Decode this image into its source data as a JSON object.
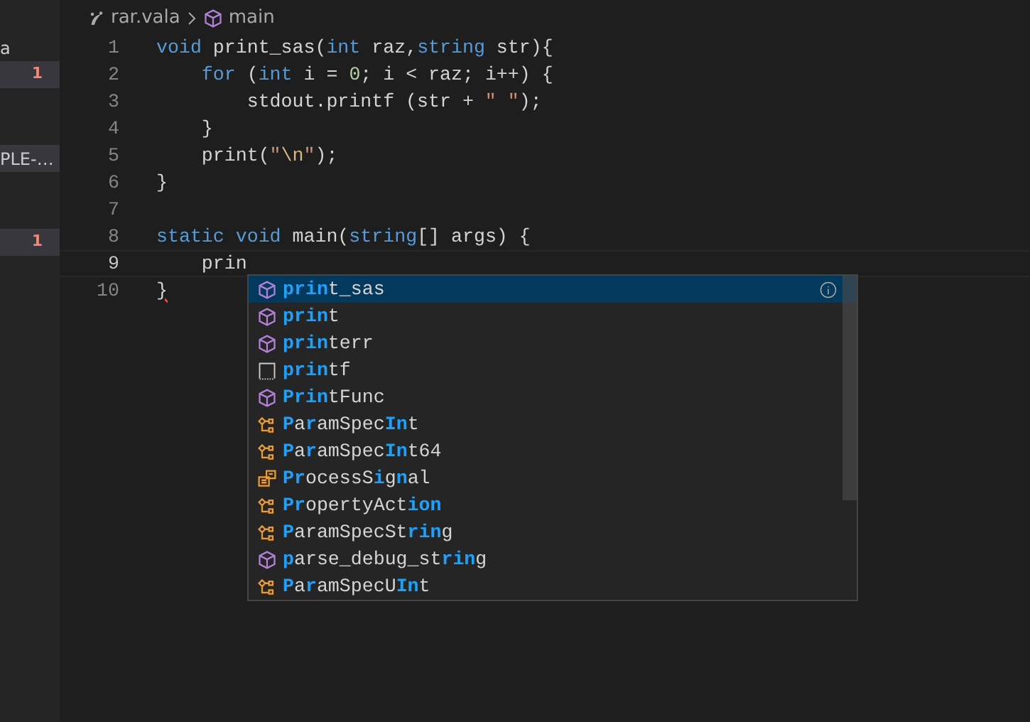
{
  "sidebar": {
    "items": [
      {
        "label": "a",
        "selected": false
      },
      {
        "badge": "1",
        "selected": true
      },
      {
        "label": "PLE-…",
        "selected": true
      },
      {
        "badge": "1",
        "selected": true
      }
    ]
  },
  "breadcrumb": [
    {
      "kind": "file",
      "label": "rar.vala"
    },
    {
      "kind": "method",
      "label": "main"
    }
  ],
  "editor": {
    "lines": [
      {
        "number": "1",
        "tokens": [
          {
            "kind": "keyword",
            "text": "void"
          },
          {
            "kind": "plain",
            "text": " print_sas("
          },
          {
            "kind": "keyword",
            "text": "int"
          },
          {
            "kind": "plain",
            "text": " raz,"
          },
          {
            "kind": "keyword",
            "text": "string"
          },
          {
            "kind": "plain",
            "text": " str){"
          }
        ]
      },
      {
        "number": "2",
        "tokens": [
          {
            "kind": "keyword",
            "text": "    for"
          },
          {
            "kind": "plain",
            "text": " ("
          },
          {
            "kind": "keyword",
            "text": "int"
          },
          {
            "kind": "plain",
            "text": " i = "
          },
          {
            "kind": "number",
            "text": "0"
          },
          {
            "kind": "plain",
            "text": "; i < raz; i++) {"
          }
        ]
      },
      {
        "number": "3",
        "tokens": [
          {
            "kind": "plain",
            "text": "        stdout.printf (str + "
          },
          {
            "kind": "string",
            "text": "\" \""
          },
          {
            "kind": "plain",
            "text": ");"
          }
        ]
      },
      {
        "number": "4",
        "tokens": [
          {
            "kind": "plain",
            "text": "    }"
          }
        ]
      },
      {
        "number": "5",
        "tokens": [
          {
            "kind": "plain",
            "text": "    print("
          },
          {
            "kind": "string",
            "text": "\""
          },
          {
            "kind": "escape",
            "text": "\\n"
          },
          {
            "kind": "string",
            "text": "\""
          },
          {
            "kind": "plain",
            "text": ");"
          }
        ]
      },
      {
        "number": "6",
        "tokens": [
          {
            "kind": "plain",
            "text": "}"
          }
        ]
      },
      {
        "number": "7"
      },
      {
        "number": "8",
        "tokens": [
          {
            "kind": "keyword",
            "text": "static void"
          },
          {
            "kind": "plain",
            "text": " main("
          },
          {
            "kind": "keyword",
            "text": "string"
          },
          {
            "kind": "plain",
            "text": "[] args) {"
          }
        ]
      },
      {
        "number": "9",
        "current": true,
        "tokens": [
          {
            "kind": "plain",
            "text": "    prin"
          }
        ]
      },
      {
        "number": "10",
        "tokens": [
          {
            "kind": "error",
            "text": "}"
          }
        ]
      }
    ]
  },
  "suggestions": [
    {
      "kind": "method",
      "selected": true,
      "segments": [
        {
          "text": "prin",
          "match": true
        },
        {
          "text": "t_sas",
          "match": false
        }
      ]
    },
    {
      "kind": "method",
      "selected": false,
      "segments": [
        {
          "text": "prin",
          "match": true
        },
        {
          "text": "t",
          "match": false
        }
      ]
    },
    {
      "kind": "method",
      "selected": false,
      "segments": [
        {
          "text": "prin",
          "match": true
        },
        {
          "text": "terr",
          "match": false
        }
      ]
    },
    {
      "kind": "snippet",
      "selected": false,
      "segments": [
        {
          "text": "prin",
          "match": true
        },
        {
          "text": "tf",
          "match": false
        }
      ]
    },
    {
      "kind": "method",
      "selected": false,
      "segments": [
        {
          "text": "Prin",
          "match": true
        },
        {
          "text": "tFunc",
          "match": false
        }
      ]
    },
    {
      "kind": "class",
      "selected": false,
      "segments": [
        {
          "text": "P",
          "match": true
        },
        {
          "text": "a",
          "match": false
        },
        {
          "text": "r",
          "match": true
        },
        {
          "text": "amSpec",
          "match": false
        },
        {
          "text": "In",
          "match": true
        },
        {
          "text": "t",
          "match": false
        }
      ]
    },
    {
      "kind": "class",
      "selected": false,
      "segments": [
        {
          "text": "P",
          "match": true
        },
        {
          "text": "a",
          "match": false
        },
        {
          "text": "r",
          "match": true
        },
        {
          "text": "amSpec",
          "match": false
        },
        {
          "text": "In",
          "match": true
        },
        {
          "text": "t64",
          "match": false
        }
      ]
    },
    {
      "kind": "enum",
      "selected": false,
      "segments": [
        {
          "text": "P",
          "match": true
        },
        {
          "text": "r",
          "match": true
        },
        {
          "text": "ocessS",
          "match": false
        },
        {
          "text": "i",
          "match": true
        },
        {
          "text": "g",
          "match": false
        },
        {
          "text": "n",
          "match": true
        },
        {
          "text": "al",
          "match": false
        }
      ]
    },
    {
      "kind": "class",
      "selected": false,
      "segments": [
        {
          "text": "Pr",
          "match": true
        },
        {
          "text": "opertyAct",
          "match": false
        },
        {
          "text": "ion",
          "match": true
        }
      ]
    },
    {
      "kind": "class",
      "selected": false,
      "segments": [
        {
          "text": "P",
          "match": true
        },
        {
          "text": "aramSpecSt",
          "match": false
        },
        {
          "text": "rin",
          "match": true
        },
        {
          "text": "g",
          "match": false
        }
      ]
    },
    {
      "kind": "method",
      "selected": false,
      "segments": [
        {
          "text": "p",
          "match": true
        },
        {
          "text": "arse_debug_st",
          "match": false
        },
        {
          "text": "rin",
          "match": true
        },
        {
          "text": "g",
          "match": false
        }
      ]
    },
    {
      "kind": "class",
      "selected": false,
      "segments": [
        {
          "text": "P",
          "match": true
        },
        {
          "text": "a",
          "match": false
        },
        {
          "text": "r",
          "match": true
        },
        {
          "text": "amSpecU",
          "match": false
        },
        {
          "text": "In",
          "match": true
        },
        {
          "text": "t",
          "match": false
        }
      ]
    }
  ]
}
